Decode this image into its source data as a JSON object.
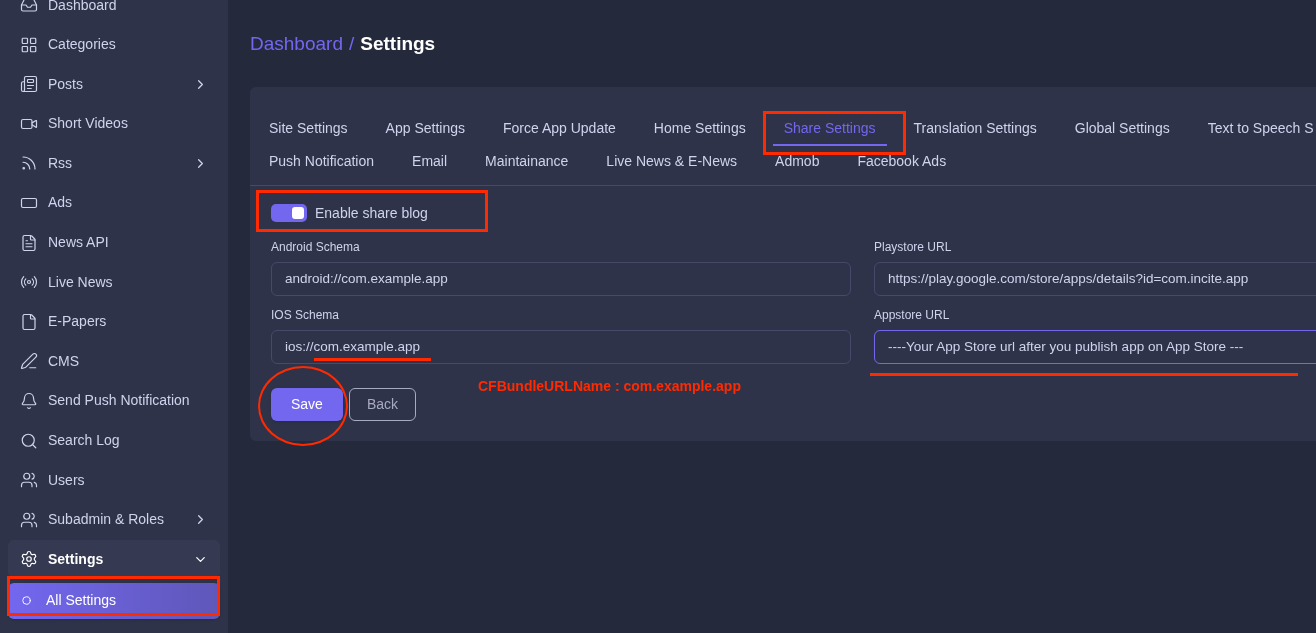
{
  "sidebar": {
    "items": [
      {
        "label": "Dashboard",
        "has_submenu": false,
        "expanded": false,
        "selected": false
      },
      {
        "label": "Categories",
        "has_submenu": false,
        "expanded": false,
        "selected": false
      },
      {
        "label": "Posts",
        "has_submenu": true,
        "expanded": false,
        "selected": false
      },
      {
        "label": "Short Videos",
        "has_submenu": false,
        "expanded": false,
        "selected": false
      },
      {
        "label": "Rss",
        "has_submenu": true,
        "expanded": false,
        "selected": false
      },
      {
        "label": "Ads",
        "has_submenu": false,
        "expanded": false,
        "selected": false
      },
      {
        "label": "News API",
        "has_submenu": false,
        "expanded": false,
        "selected": false
      },
      {
        "label": "Live News",
        "has_submenu": false,
        "expanded": false,
        "selected": false
      },
      {
        "label": "E-Papers",
        "has_submenu": false,
        "expanded": false,
        "selected": false
      },
      {
        "label": "CMS",
        "has_submenu": false,
        "expanded": false,
        "selected": false
      },
      {
        "label": "Send Push Notification",
        "has_submenu": false,
        "expanded": false,
        "selected": false
      },
      {
        "label": "Search Log",
        "has_submenu": false,
        "expanded": false,
        "selected": false
      },
      {
        "label": "Users",
        "has_submenu": false,
        "expanded": false,
        "selected": false
      },
      {
        "label": "Subadmin & Roles",
        "has_submenu": true,
        "expanded": false,
        "selected": false
      },
      {
        "label": "Settings",
        "has_submenu": true,
        "expanded": true,
        "selected": false,
        "children": [
          {
            "label": "All Settings",
            "selected": true
          }
        ]
      }
    ]
  },
  "breadcrumb": {
    "parent": "Dashboard",
    "separator": "/",
    "current": "Settings"
  },
  "tabs": [
    [
      {
        "label": "Site Settings",
        "selected": false
      },
      {
        "label": "App Settings",
        "selected": false
      },
      {
        "label": "Force App Update",
        "selected": false
      },
      {
        "label": "Home Settings",
        "selected": false
      },
      {
        "label": "Share Settings",
        "selected": true
      },
      {
        "label": "Translation Settings",
        "selected": false
      },
      {
        "label": "Global Settings",
        "selected": false
      },
      {
        "label": "Text to Speech S",
        "selected": false
      }
    ],
    [
      {
        "label": "Push Notification",
        "selected": false
      },
      {
        "label": "Email",
        "selected": false
      },
      {
        "label": "Maintainance",
        "selected": false
      },
      {
        "label": "Live News & E-News",
        "selected": false
      },
      {
        "label": "Admob",
        "selected": false
      },
      {
        "label": "Facebook Ads",
        "selected": false
      }
    ]
  ],
  "toggle": {
    "label": "Enable share blog",
    "on": true
  },
  "fields": [
    {
      "label": "Android Schema",
      "value": "android://com.example.app",
      "focused": false
    },
    {
      "label": "Playstore URL",
      "value": "https://play.google.com/store/apps/details?id=com.incite.app",
      "focused": false
    },
    {
      "label": "IOS Schema",
      "value": "ios://com.example.app",
      "focused": false
    },
    {
      "label": "Appstore URL",
      "value": "----Your App Store url after you publish app on App Store ---",
      "focused": true
    }
  ],
  "buttons": {
    "save": "Save",
    "back": "Back"
  },
  "annotations": [
    {
      "kind": "box"
    },
    {
      "kind": "box"
    },
    {
      "kind": "box"
    },
    {
      "kind": "circle"
    },
    {
      "kind": "underline"
    },
    {
      "kind": "underline"
    },
    {
      "kind": "text",
      "text": "CFBundleURLName : com.example.app"
    }
  ]
}
